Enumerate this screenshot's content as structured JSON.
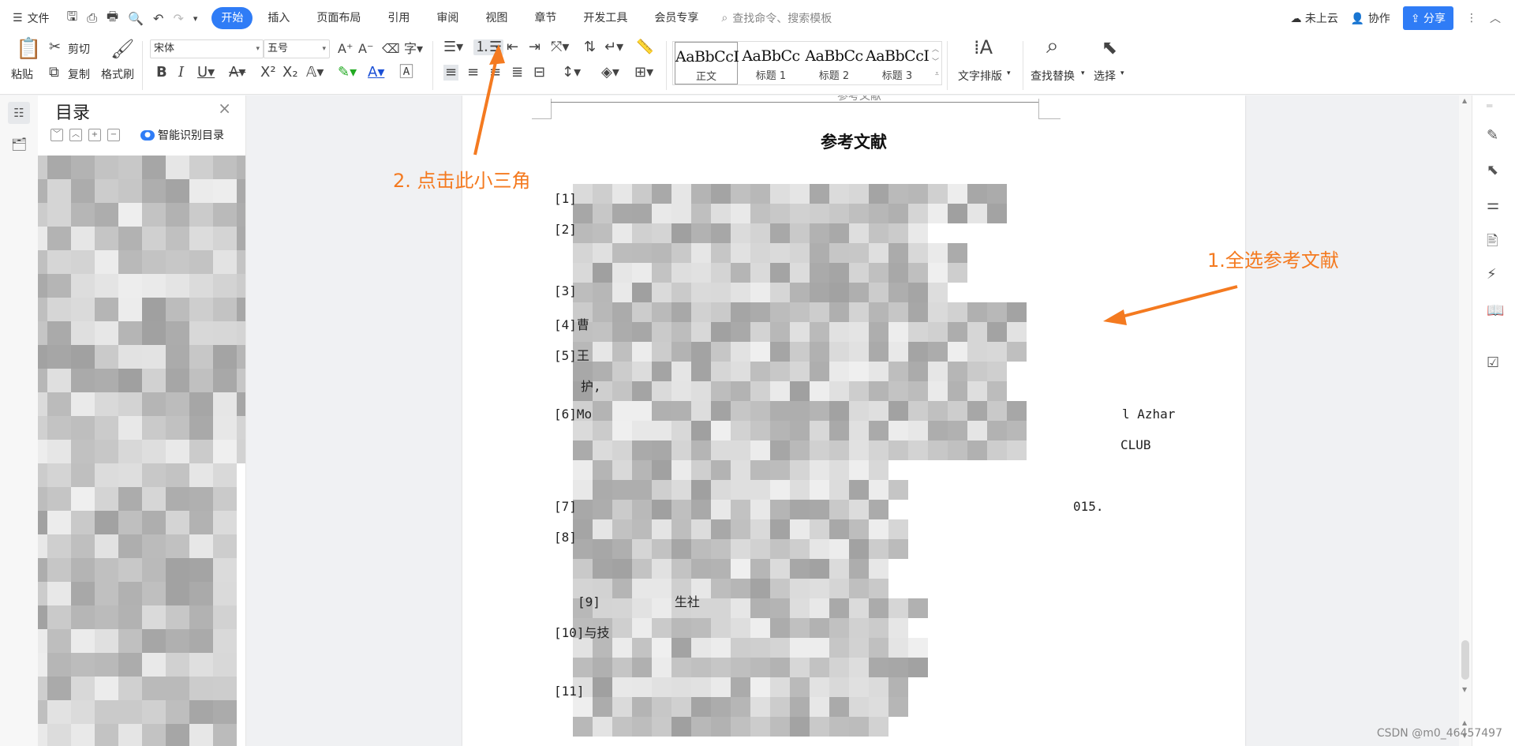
{
  "menubar": {
    "file_label": "文件",
    "tabs": [
      "开始",
      "插入",
      "页面布局",
      "引用",
      "审阅",
      "视图",
      "章节",
      "开发工具",
      "会员专享"
    ],
    "search_placeholder": "查找命令、搜索模板",
    "cloud_label": "未上云",
    "collab_label": "协作",
    "share_label": "分享"
  },
  "ribbon": {
    "paste": "粘贴",
    "cut": "剪切",
    "copy": "复制",
    "format_painter": "格式刷",
    "font_name": "宋体",
    "font_size": "五号",
    "styles": [
      {
        "sample": "AaBbCcI",
        "name": "正文"
      },
      {
        "sample": "AaBbCc",
        "name": "标题 1"
      },
      {
        "sample": "AaBbCc",
        "name": "标题 2"
      },
      {
        "sample": "AaBbCcI",
        "name": "标题 3"
      }
    ],
    "text_layout": "文字排版",
    "find_replace": "查找替换",
    "select": "选择"
  },
  "nav": {
    "title": "目录",
    "smart_toc": "智能识别目录"
  },
  "document": {
    "heading_partial": "参考文献",
    "title": "参考文献",
    "refs": [
      {
        "num": "[1]",
        "text": ""
      },
      {
        "num": "[2]",
        "text": ""
      },
      {
        "num": "[3]",
        "text": ""
      },
      {
        "num": "[4]",
        "text": "曹"
      },
      {
        "num": "[5]",
        "text": "王"
      },
      {
        "num": "",
        "text": "护,"
      },
      {
        "num": "[6]",
        "text": "Mo"
      },
      {
        "num": "",
        "text": "l Azhar"
      },
      {
        "num": "",
        "text": "CLUB"
      },
      {
        "num": "[7]",
        "text": ""
      },
      {
        "num": "",
        "text": "015."
      },
      {
        "num": "[8]",
        "text": ""
      },
      {
        "num": "[9]",
        "text": "生社"
      },
      {
        "num": "[10]",
        "text": "与技"
      },
      {
        "num": "[11]",
        "text": ""
      }
    ]
  },
  "annotations": {
    "step1": "1.全选参考文献",
    "step2": "2. 点击此小三角"
  },
  "watermark": "CSDN @m0_46457497",
  "colors": {
    "accent": "#2f7cf6",
    "annotation": "#f47a20"
  }
}
